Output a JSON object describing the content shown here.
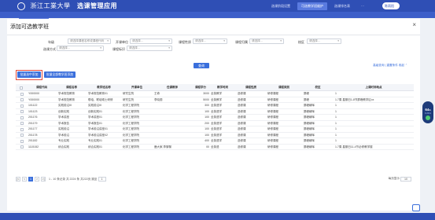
{
  "topbar": {
    "school": "浙江工業大學",
    "app_title": "选课管理应用",
    "nav": [
      "选课阶段设置",
      "可选教学班维护",
      "选课排名表",
      "···"
    ],
    "active_index": 1,
    "user": "陈雨阳"
  },
  "subbar": {
    "tab": "可选教学班维护"
  },
  "modal": {
    "title": "添加可选教学班",
    "close": "×",
    "filters": [
      {
        "label": "年级",
        "value": "请选择课程名称或课程代码"
      },
      {
        "label": "开课单位",
        "value": "请选择..."
      },
      {
        "label": "课程性质",
        "value": "请选择..."
      },
      {
        "label": "课程归属",
        "value": "请选择..."
      },
      {
        "label": "校区",
        "value": "请选择..."
      },
      {
        "label": "选课方式",
        "value": "请选择..."
      },
      {
        "label": "课程标识",
        "value": "请选择..."
      }
    ],
    "search_label": "查询",
    "right_links": "高级查询 | 重置条件   收起 ⌃",
    "btn_add_selected": "批量选中添加",
    "btn_add_all": "批量全部教学班添加"
  },
  "table": {
    "headers": [
      "",
      "课程代码",
      "课程名称",
      "教学班名称",
      "开课单位",
      "任课教师",
      "课程学分",
      "教学时间",
      "课程性质",
      "课程类别",
      "校区",
      "上课时间地点"
    ],
    "rows": [
      [
        "",
        "Y000000",
        "学术规范教育",
        "学术规范教育01",
        "研究生院",
        "王奇",
        "3000",
        "全英教学",
        "选修课",
        "研修课程",
        "屏峰",
        "1"
      ],
      [
        "",
        "Y000000",
        "学术规范教育",
        "联培、联培硕士研修",
        "研究生院",
        "李晓丽",
        "5000",
        "全英教学",
        "选修课",
        "研修课程",
        "屏峰",
        "1.7周 星期日1-8节屏峰教学区xx"
      ],
      [
        "",
        "101122",
        "实践前沿III",
        "实践前沿III",
        "化学工程学院",
        "",
        "300",
        "全英语学",
        "选修课",
        "研修课程",
        "屏峰朝晖",
        "1"
      ],
      [
        "",
        "101123",
        "创新实践",
        "创新实践01",
        "化学工程学院",
        "",
        "100",
        "全英语学",
        "选修课",
        "研修课程",
        "屏峰朝晖",
        "1"
      ],
      [
        "",
        "201176",
        "学术讲座",
        "学术讲座01",
        "化学工程学院",
        "",
        "100",
        "全英语学",
        "选修课",
        "研修课程",
        "屏峰朝晖",
        "1"
      ],
      [
        "",
        "201179",
        "学术报告",
        "学术报告01",
        "化学工程学院",
        "",
        "200",
        "全英语学",
        "选修课",
        "研修课程",
        "屏峰朝晖",
        "1"
      ],
      [
        "",
        "201177",
        "实践前沿",
        "学术前沿讲座01",
        "化学工程学院",
        "",
        "100",
        "全英语学",
        "选修课",
        "研修课程",
        "屏峰朝晖",
        "1"
      ],
      [
        "",
        "201178",
        "学术前沿",
        "学术前沿讲座02",
        "化学工程学院",
        "",
        "100",
        "全英语学",
        "选修课",
        "研修课程",
        "屏峰朝晖",
        "1"
      ],
      [
        "",
        "201182",
        "专业实践",
        "专业实践01",
        "化学工程学院",
        "",
        "400",
        "全英语学",
        "选修课",
        "研修课程",
        "屏峰朝晖",
        "1"
      ],
      [
        "",
        "1115152",
        "综合实践",
        "综合实践01",
        "化学工程学院",
        "鹿大家,李黎黎",
        "00",
        "全英语",
        "选修课",
        "研修课程",
        "屏峰朝晖",
        "1.7周 星期日11-4节必修教学楼"
      ]
    ]
  },
  "pager": {
    "first": "|<",
    "prev": "<",
    "page": "1",
    "next": ">",
    "last": ">|",
    "summary": "1 - 10 条记录 共 2224 条  共222页  跳至",
    "goto_value": "1",
    "right_label": "每页显示",
    "page_size": "10"
  },
  "side_widget": {
    "percent": "64",
    "unit": "%",
    "sub": "0.2K/s"
  }
}
